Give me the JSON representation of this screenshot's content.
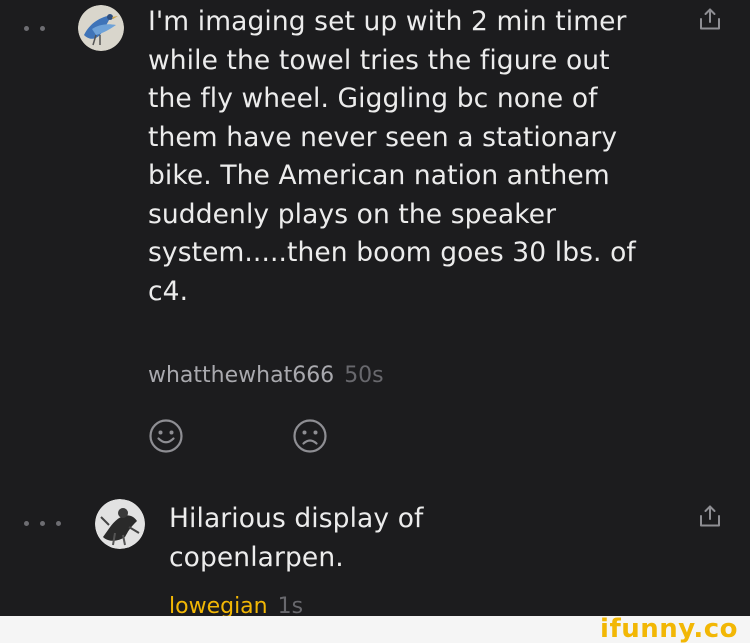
{
  "comments": [
    {
      "text": "I'm imaging set up with 2 min timer while the towel tries the figure out the fly wheel. Giggling bc none of them have never seen a stationary bike. The American nation anthem suddenly plays on the speaker system.....then boom goes 30 lbs. of c4.",
      "author": "whatthewhat666",
      "time": "50s",
      "avatar": "bird-avatar-icon"
    },
    {
      "text": "Hilarious display of copenlarpen.",
      "author": "lowegian",
      "time": "1s",
      "avatar": "figure-avatar-icon"
    }
  ],
  "reactions": {
    "smile": "smile-icon",
    "sad": "sad-icon"
  },
  "watermark": {
    "brand": "ifunny.co"
  },
  "colors": {
    "background": "#1c1c1e",
    "text": "#ececec",
    "author_gray": "#a9a9ae",
    "author_highlight": "#f2b705",
    "timestamp": "#68686d",
    "icon": "#8e8e93"
  }
}
